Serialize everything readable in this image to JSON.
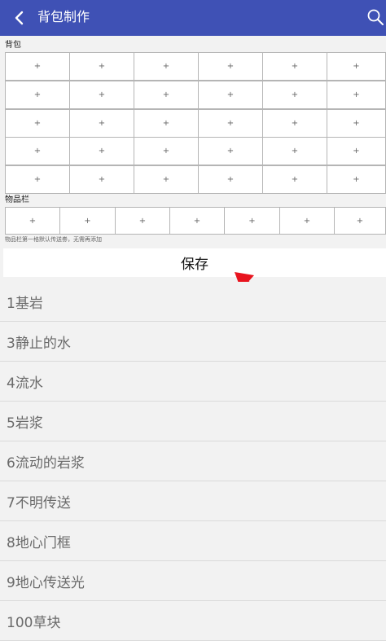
{
  "header": {
    "title": "背包制作",
    "back_icon": "back-arrow-icon",
    "search_icon": "search-icon",
    "color": "#3f51b5"
  },
  "backpack": {
    "label": "背包",
    "rows": 5,
    "cols": 6,
    "slot_symbol": "+"
  },
  "hotbar": {
    "label": "物品栏",
    "slots": 7,
    "slot_symbol": "+",
    "hint": "物品栏第一格默认传送劵，无需再添加"
  },
  "save_label": "保存",
  "pointer_icon": "red-arrow-icon",
  "items": [
    "1基岩",
    "3静止的水",
    "4流水",
    "5岩浆",
    "6流动的岩浆",
    "7不明传送",
    "8地心门框",
    "9地心传送光",
    "100草块"
  ]
}
